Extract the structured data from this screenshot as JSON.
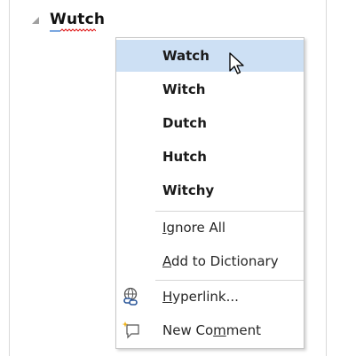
{
  "document": {
    "word_prefix": "W",
    "word_rest": "utch"
  },
  "menu": {
    "suggestions": [
      "Watch",
      "Witch",
      "Dutch",
      "Hutch",
      "Witchy"
    ],
    "ignore_all": {
      "pre": "",
      "acc": "I",
      "post": "gnore All"
    },
    "add_to_dictionary": {
      "pre": "",
      "acc": "A",
      "post": "dd to Dictionary"
    },
    "hyperlink": {
      "pre": "",
      "acc": "H",
      "post": "yperlink..."
    },
    "new_comment": {
      "pre": "New Co",
      "acc": "m",
      "post": "ment"
    },
    "hovered_item": "Watch"
  },
  "icons": {
    "heading_collapse": "collapse-triangle-icon",
    "hyperlink": "hyperlink-icon",
    "new_comment": "new-comment-icon",
    "cursor": "mouse-pointer-icon"
  },
  "colors": {
    "hover_background": "#cde0f4",
    "spelling_squiggle": "#e02020",
    "hyperlink_icon": "#2b579a",
    "comment_star": "#f2b318"
  }
}
